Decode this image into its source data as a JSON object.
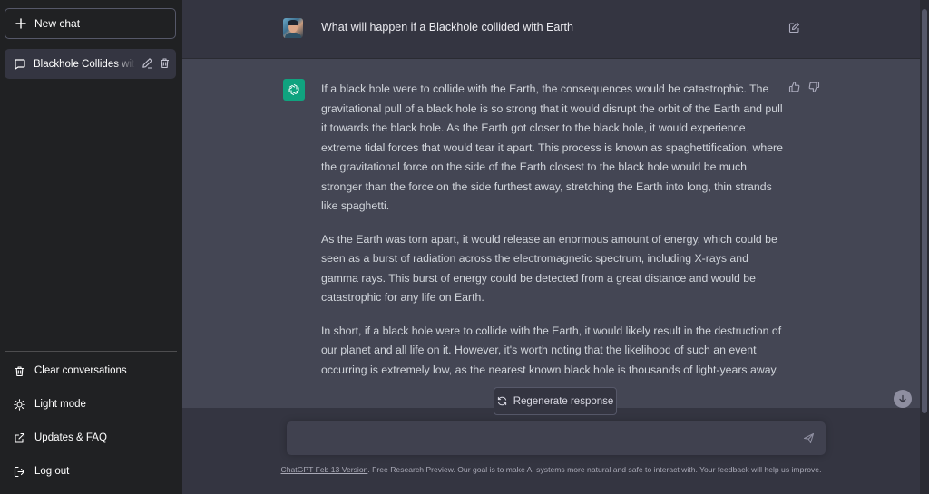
{
  "sidebar": {
    "new_chat_label": "New chat",
    "conversations": [
      {
        "title": "Blackhole Collides with Earth"
      }
    ],
    "links": [
      {
        "label": "Clear conversations",
        "icon": "trash-icon"
      },
      {
        "label": "Light mode",
        "icon": "sun-icon"
      },
      {
        "label": "Updates & FAQ",
        "icon": "external-link-icon"
      },
      {
        "label": "Log out",
        "icon": "logout-icon"
      }
    ]
  },
  "thread": {
    "user_message": "What will happen if a Blackhole collided with Earth",
    "assistant_paragraphs": [
      "If a black hole were to collide with the Earth, the consequences would be catastrophic. The gravitational pull of a black hole is so strong that it would disrupt the orbit of the Earth and pull it towards the black hole. As the Earth got closer to the black hole, it would experience extreme tidal forces that would tear it apart. This process is known as spaghettification, where the gravitational force on the side of the Earth closest to the black hole would be much stronger than the force on the side furthest away, stretching the Earth into long, thin strands like spaghetti.",
      "As the Earth was torn apart, it would release an enormous amount of energy, which could be seen as a burst of radiation across the electromagnetic spectrum, including X-rays and gamma rays. This burst of energy could be detected from a great distance and would be catastrophic for any life on Earth.",
      "In short, if a black hole were to collide with the Earth, it would likely result in the destruction of our planet and all life on it. However, it's worth noting that the likelihood of such an event occurring is extremely low, as the nearest known black hole is thousands of light-years away."
    ]
  },
  "composer": {
    "regenerate_label": "Regenerate response",
    "input_value": ""
  },
  "footer": {
    "version_link": "ChatGPT Feb 13 Version",
    "text": ". Free Research Preview. Our goal is to make AI systems more natural and safe to interact with. Your feedback will help us improve."
  },
  "colors": {
    "sidebar_bg": "#202123",
    "main_bg": "#343541",
    "assistant_bg": "#444654",
    "brand_green": "#10a37f"
  }
}
